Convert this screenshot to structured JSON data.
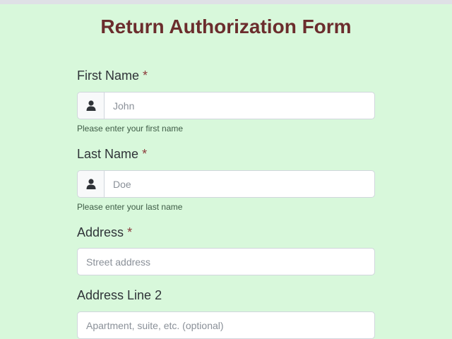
{
  "form": {
    "title": "Return Authorization Form",
    "required_marker": "*",
    "fields": {
      "first_name": {
        "label": "First Name",
        "placeholder": "John",
        "value": "",
        "help": "Please enter your first name",
        "icon": "user-icon"
      },
      "last_name": {
        "label": "Last Name",
        "placeholder": "Doe",
        "value": "",
        "help": "Please enter your last name",
        "icon": "user-icon"
      },
      "address": {
        "label": "Address",
        "placeholder": "Street address",
        "value": ""
      },
      "address_line_2": {
        "label": "Address Line 2",
        "placeholder": "Apartment, suite, etc. (optional)",
        "value": ""
      }
    }
  },
  "colors": {
    "background": "#d8f8db",
    "title": "#6b2d2d",
    "required": "#8b3a3a"
  }
}
